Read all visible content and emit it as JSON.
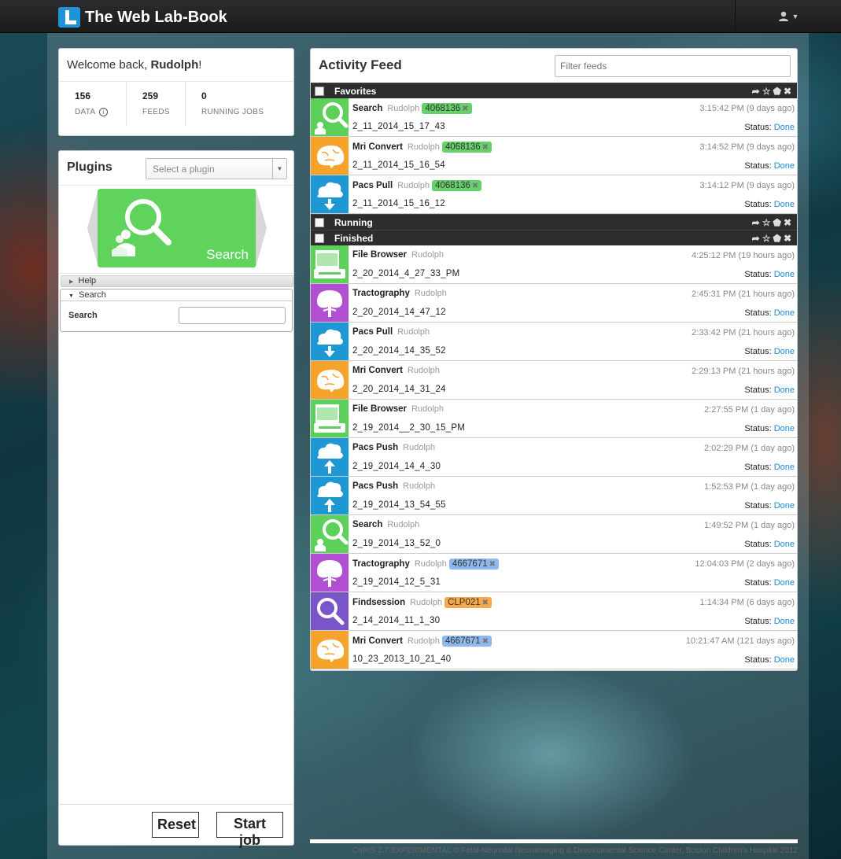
{
  "navbar": {
    "brand": "The Web Lab-Book",
    "user_icon": "user-icon"
  },
  "welcome": {
    "prefix": "Welcome back, ",
    "name": "Rudolph",
    "suffix": "!",
    "stats": [
      {
        "value": "156",
        "label": "DATA"
      },
      {
        "value": "259",
        "label": "FEEDS"
      },
      {
        "value": "0",
        "label": "RUNNING JOBS"
      }
    ]
  },
  "plugins": {
    "title": "Plugins",
    "select_placeholder": "Select a plugin",
    "carousel_label": "Search",
    "help_label": "Help",
    "search_section": "Search",
    "search_field_label": "Search",
    "reset_label": "Reset",
    "start_label": "Start job"
  },
  "feed": {
    "title": "Activity Feed",
    "filter_placeholder": "Filter feeds",
    "groups": {
      "favorites": "Favorites",
      "running": "Running",
      "finished": "Finished"
    },
    "status_prefix": "Status: ",
    "favorites": [
      {
        "name": "Search",
        "user": "Rudolph",
        "tag": "4068136",
        "tag_color": "#66d16b",
        "time": "3:15:42 PM (9 days ago)",
        "job": "2_11_2014_15_17_43",
        "status": "Done",
        "icon": "search",
        "color": "#5cd05a"
      },
      {
        "name": "Mri Convert",
        "user": "Rudolph",
        "tag": "4068136",
        "tag_color": "#66d16b",
        "time": "3:14:52 PM (9 days ago)",
        "job": "2_11_2014_15_16_54",
        "status": "Done",
        "icon": "brain",
        "color": "#f5a32a"
      },
      {
        "name": "Pacs Pull",
        "user": "Rudolph",
        "tag": "4068136",
        "tag_color": "#66d16b",
        "time": "3:14:12 PM (9 days ago)",
        "job": "2_11_2014_15_16_12",
        "status": "Done",
        "icon": "cloud-down",
        "color": "#1e98d4"
      }
    ],
    "finished": [
      {
        "name": "File Browser",
        "user": "Rudolph",
        "tag": "",
        "tag_color": "",
        "time": "4:25:12 PM (19 hours ago)",
        "job": "2_20_2014_4_27_33_PM",
        "status": "Done",
        "icon": "folder",
        "color": "#5cd05a"
      },
      {
        "name": "Tractography",
        "user": "Rudolph",
        "tag": "",
        "tag_color": "",
        "time": "2:45:31 PM (21 hours ago)",
        "job": "2_20_2014_14_47_12",
        "status": "Done",
        "icon": "tree-brain",
        "color": "#b04fd1"
      },
      {
        "name": "Pacs Pull",
        "user": "Rudolph",
        "tag": "",
        "tag_color": "",
        "time": "2:33:42 PM (21 hours ago)",
        "job": "2_20_2014_14_35_52",
        "status": "Done",
        "icon": "cloud-down",
        "color": "#1e98d4"
      },
      {
        "name": "Mri Convert",
        "user": "Rudolph",
        "tag": "",
        "tag_color": "",
        "time": "2:29:13 PM (21 hours ago)",
        "job": "2_20_2014_14_31_24",
        "status": "Done",
        "icon": "brain",
        "color": "#f5a32a"
      },
      {
        "name": "File Browser",
        "user": "Rudolph",
        "tag": "",
        "tag_color": "",
        "time": "2:27:55 PM (1 day ago)",
        "job": "2_19_2014__2_30_15_PM",
        "status": "Done",
        "icon": "folder",
        "color": "#5cd05a"
      },
      {
        "name": "Pacs Push",
        "user": "Rudolph",
        "tag": "",
        "tag_color": "",
        "time": "2:02:29 PM (1 day ago)",
        "job": "2_19_2014_14_4_30",
        "status": "Done",
        "icon": "cloud-up",
        "color": "#1e98d4"
      },
      {
        "name": "Pacs Push",
        "user": "Rudolph",
        "tag": "",
        "tag_color": "",
        "time": "1:52:53 PM (1 day ago)",
        "job": "2_19_2014_13_54_55",
        "status": "Done",
        "icon": "cloud-up",
        "color": "#1e98d4"
      },
      {
        "name": "Search",
        "user": "Rudolph",
        "tag": "",
        "tag_color": "",
        "time": "1:49:52 PM (1 day ago)",
        "job": "2_19_2014_13_52_0",
        "status": "Done",
        "icon": "search",
        "color": "#5cd05a"
      },
      {
        "name": "Tractography",
        "user": "Rudolph",
        "tag": "4667671",
        "tag_color": "#8fb9ee",
        "time": "12:04:03 PM (2 days ago)",
        "job": "2_19_2014_12_5_31",
        "status": "Done",
        "icon": "tree-brain",
        "color": "#b04fd1"
      },
      {
        "name": "Findsession",
        "user": "Rudolph",
        "tag": "CLP021",
        "tag_color": "#f5a94a",
        "time": "1:14:34 PM (6 days ago)",
        "job": "2_14_2014_11_1_30",
        "status": "Done",
        "icon": "magnifier",
        "color": "#7a55c9"
      },
      {
        "name": "Mri Convert",
        "user": "Rudolph",
        "tag": "4667671",
        "tag_color": "#8fb9ee",
        "time": "10:21:47 AM (121 days ago)",
        "job": "10_23_2013_10_21_40",
        "status": "Done",
        "icon": "brain",
        "color": "#f5a32a"
      }
    ]
  },
  "footer": "ChRIS 2.7-EXPERIMENTAL © Fetal-Neonatal Neuroimaging & Developmental Science Center, Boston Children's Hospital 2012"
}
